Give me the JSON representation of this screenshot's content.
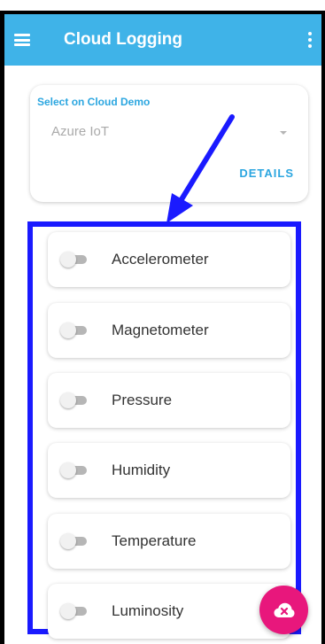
{
  "appbar": {
    "title": "Cloud Logging",
    "menu_icon": "menu-icon",
    "overflow_icon": "more-vert-icon",
    "color": "#3fb3e8"
  },
  "cloud_select": {
    "label": "Select on Cloud Demo",
    "value": "Azure IoT",
    "details_label": "DETAILS"
  },
  "sensors": [
    {
      "label": "Accelerometer",
      "enabled": false
    },
    {
      "label": "Magnetometer",
      "enabled": false
    },
    {
      "label": "Pressure",
      "enabled": false
    },
    {
      "label": "Humidity",
      "enabled": false
    },
    {
      "label": "Temperature",
      "enabled": false
    },
    {
      "label": "Luminosity",
      "enabled": false
    }
  ],
  "annotation": {
    "arrow_color": "#1a1aff",
    "highlight_color": "#1a1aff"
  },
  "fab": {
    "icon": "cloud-off-icon",
    "color": "#e8177c"
  }
}
